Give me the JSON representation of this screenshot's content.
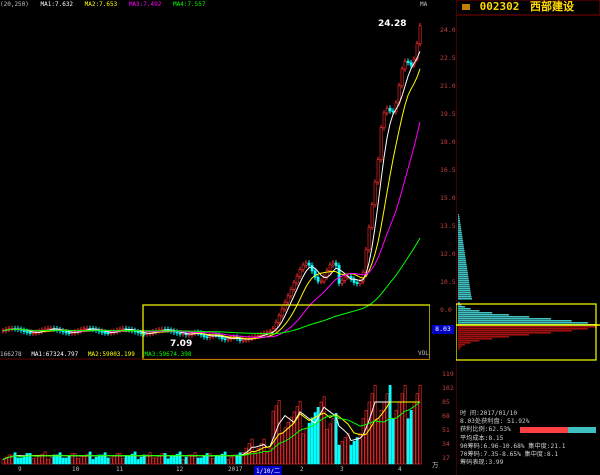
{
  "top_bar": {
    "period": "(20,250)",
    "ma1": "MA1:7.632",
    "ma2": "MA2:7.653",
    "ma3": "MA3:7.492",
    "ma4": "MA4:7.557",
    "right_tag": "MA"
  },
  "main_chart": {
    "high_label": "24.28",
    "low_label": "7.09",
    "vol_tag": "VOL",
    "axis_ticks": [
      "24.0",
      "22.5",
      "21.0",
      "19.5",
      "18.0",
      "16.5",
      "15.0",
      "13.5",
      "12.0",
      "10.5",
      "9.0"
    ],
    "current_price": "8.03"
  },
  "vol_bar": {
    "v": "166278",
    "ma1": "MA1:67324.797",
    "ma2": "MA2:59003.199",
    "ma3": "MA3:59674.398"
  },
  "vol_axis_ticks": [
    "119",
    "102",
    "85",
    "68",
    "51",
    "34",
    "17"
  ],
  "vol_unit": "万",
  "date_axis": [
    "9",
    "10",
    "11",
    "12",
    "2017",
    "1/10/二",
    "2",
    "3",
    "4"
  ],
  "side": {
    "code": "002302",
    "name": "西部建设"
  },
  "stats": [
    "时          间:2017/01/10",
    "8.03处获利盘: 51.92%",
    "获利比例:62.53%",
    "平均成本:8.15",
    "90筹码:6.96-10.68% 集中度:21.1",
    "70筹码:7.35-8.65% 集中度:8.1",
    "筹码表现:3.99"
  ],
  "colors": {
    "up": "#ff3030",
    "down": "#00ffff",
    "ma1": "#ffffff",
    "ma2": "#ffff00",
    "ma3": "#ff00ff",
    "ma4": "#00ff00",
    "highlight_box": "#ffff00",
    "profit_bar": "#ff4040",
    "cost_dist_red": "#a01010",
    "cost_dist_cyan": "#40c0c0"
  }
}
